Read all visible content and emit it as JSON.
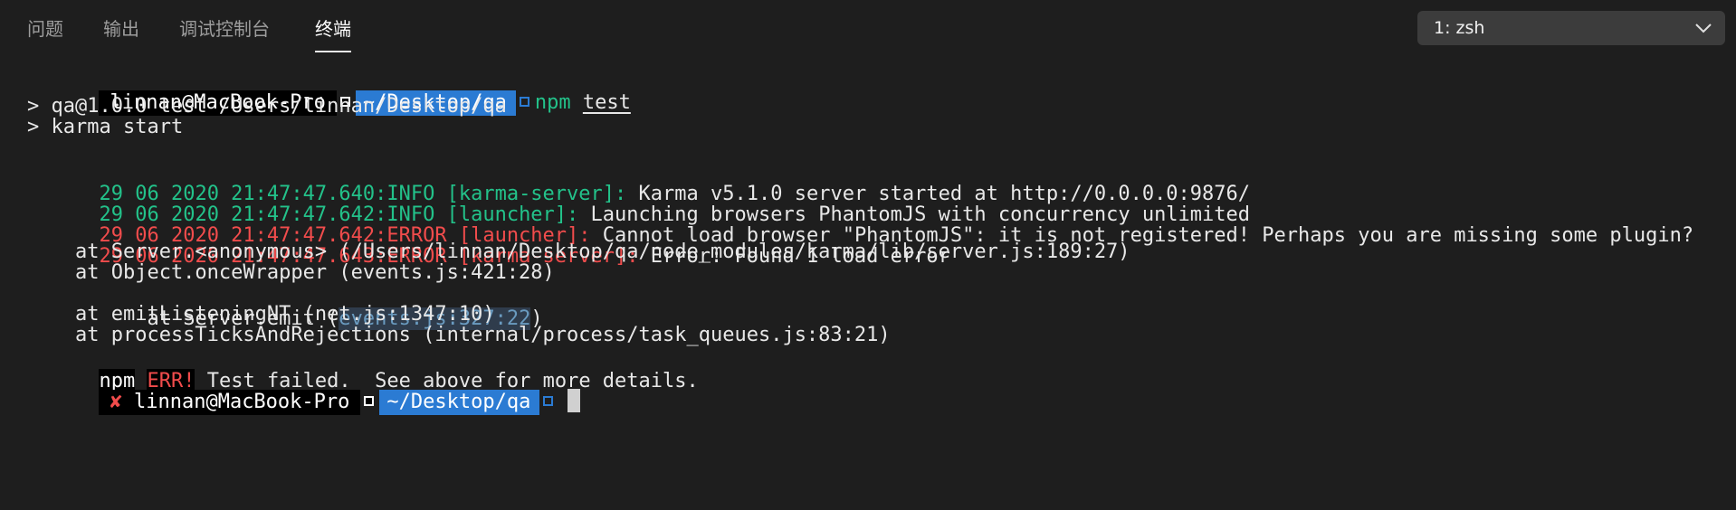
{
  "tabs": [
    {
      "label": "问题"
    },
    {
      "label": "输出"
    },
    {
      "label": "调试控制台"
    },
    {
      "label": "终端"
    }
  ],
  "active_tab": "终端",
  "terminal_select": {
    "value": "1: zsh"
  },
  "prompt1": {
    "host": "linnan@MacBook-Pro",
    "cwd": "~/Desktop/qa",
    "cmd": "npm",
    "arg": "test"
  },
  "script_lines": [
    "> qa@1.0.0 test /Users/linnan/Desktop/qa",
    "> karma start"
  ],
  "logs": [
    {
      "prefix": "29 06 2020 21:47:47.640:INFO [karma-server]:",
      "message": " Karma v5.1.0 server started at http://0.0.0.0:9876/",
      "level": "info"
    },
    {
      "prefix": "29 06 2020 21:47:47.642:INFO [launcher]:",
      "message": " Launching browsers PhantomJS with concurrency unlimited",
      "level": "info"
    },
    {
      "prefix": "29 06 2020 21:47:47.642:ERROR [launcher]:",
      "message": " Cannot load browser \"PhantomJS\": it is not registered! Perhaps you are missing some plugin?",
      "level": "error"
    },
    {
      "prefix": "29 06 2020 21:47:47.643:ERROR [karma-server]:",
      "message": " Error: Found 1 load error",
      "level": "error"
    }
  ],
  "stack": {
    "l1": "    at Server.<anonymous> (/Users/linnan/Desktop/qa/node_modules/karma/lib/server.js:189:27)",
    "l2": "    at Object.onceWrapper (events.js:421:28)",
    "l3_pre": "    at Server.emit (",
    "l3_link": "events.js:327:22",
    "l3_post": ")",
    "l4": "    at emitListeningNT (net.js:1347:10)",
    "l5": "    at processTicksAndRejections (internal/process/task_queues.js:83:21)"
  },
  "npm_err": {
    "npm": "npm",
    "err": "ERR!",
    "msg": " Test failed.  See above for more details."
  },
  "prompt2": {
    "status": "✘",
    "host": "linnan@MacBook-Pro",
    "cwd": "~/Desktop/qa"
  },
  "colors": {
    "background": "#1e1e1e",
    "info_green": "#23c28a",
    "error_red": "#f14c4c",
    "prompt_blue": "#2b7bd3"
  }
}
